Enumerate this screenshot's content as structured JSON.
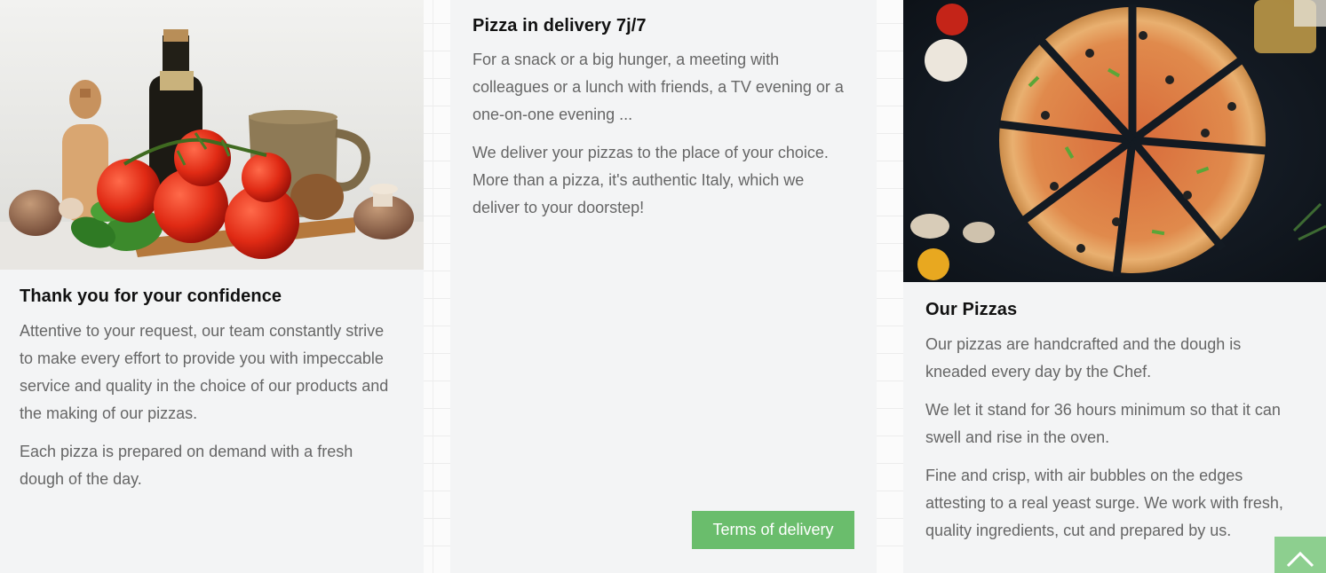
{
  "cards": [
    {
      "title": "Thank you for your confidence",
      "paragraphs": [
        "Attentive to your request, our team constantly strive to make every effort to provide you with impeccable service and quality in the choice of our products and the making of our pizzas.",
        "Each pizza is prepared on demand with a fresh dough of the day."
      ]
    },
    {
      "title": "Pizza in delivery 7j/7",
      "paragraphs": [
        "For a snack or a big hunger, a meeting with colleagues or a lunch with friends, a TV evening or a one-on-one evening ...",
        "We deliver your pizzas to the place of your choice. More than a pizza, it's authentic Italy, which we deliver to your doorstep!"
      ],
      "button_label": "Terms of delivery"
    },
    {
      "title": "Our Pizzas",
      "paragraphs": [
        "Our pizzas are handcrafted and the dough is kneaded every day by the Chef.",
        "We let it stand for 36 hours minimum so that it can swell and rise in the oven.",
        "Fine and crisp, with air bubbles on the edges attesting to a real yeast surge. We work with fresh, quality ingredients, cut and prepared by us."
      ]
    }
  ],
  "icons": {
    "scroll_top": "chevron-up-icon"
  },
  "colors": {
    "button_green": "#6abd6c",
    "scroll_top_green": "#8dcf8f",
    "card_bg": "#f3f4f5",
    "heading": "#111111",
    "body_text": "#666666"
  }
}
